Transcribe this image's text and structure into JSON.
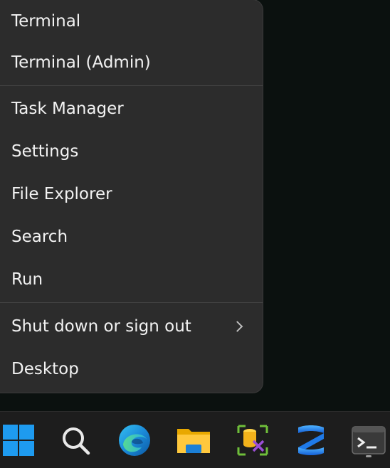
{
  "context_menu": {
    "items": [
      {
        "label": "Terminal"
      },
      {
        "label": "Terminal (Admin)"
      },
      {
        "label": "Task Manager"
      },
      {
        "label": "Settings"
      },
      {
        "label": "File Explorer"
      },
      {
        "label": "Search"
      },
      {
        "label": "Run"
      },
      {
        "label": "Shut down or sign out"
      },
      {
        "label": "Desktop"
      }
    ]
  },
  "taskbar": {
    "apps": [
      {
        "icon": "windows-start-icon"
      },
      {
        "icon": "search-icon"
      },
      {
        "icon": "edge-browser-icon"
      },
      {
        "icon": "file-explorer-icon"
      },
      {
        "icon": "database-tool-icon"
      },
      {
        "icon": "blue-app-icon"
      },
      {
        "icon": "terminal-icon"
      }
    ]
  },
  "colors": {
    "menu_bg": "#2c2c2c",
    "menu_text": "#f2f2f2",
    "taskbar_bg": "#1d1d1d",
    "desktop_bg": "#0b110f",
    "windows_blue": "#1e9bf0"
  }
}
